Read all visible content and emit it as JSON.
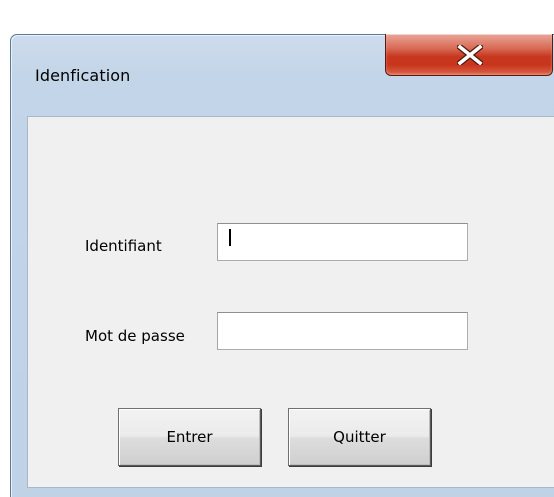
{
  "window": {
    "title": "Idenfication",
    "close_icon": "close-x-icon"
  },
  "form": {
    "identifiant_label": "Identifiant",
    "identifiant_value": "",
    "password_label": "Mot de passe",
    "password_value": ""
  },
  "buttons": {
    "enter_label": "Entrer",
    "quit_label": "Quitter"
  },
  "colors": {
    "close_button": "#c7371f",
    "frame": "#c3d5e8",
    "client": "#f0f0f0"
  }
}
